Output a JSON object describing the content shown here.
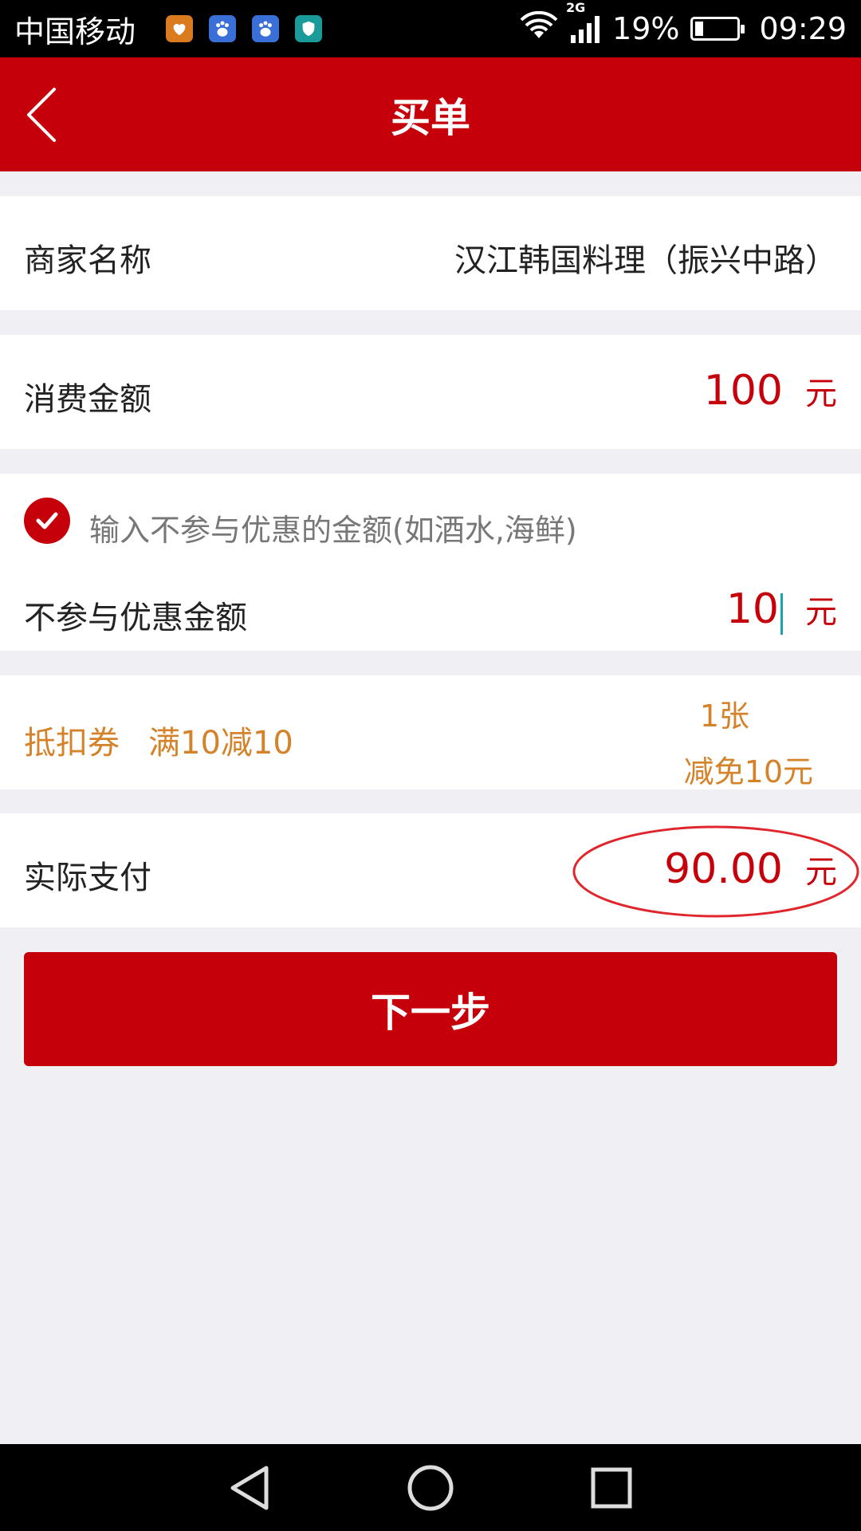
{
  "status_bar": {
    "carrier": "中国移动",
    "network": "2G",
    "battery": "19%",
    "battery_level": 0.19,
    "time": "09:29",
    "icons": [
      "health-app-icon",
      "baidu-icon",
      "baidu-icon",
      "security-shield-icon",
      "wifi-icon",
      "signal-icon",
      "battery-icon"
    ]
  },
  "header": {
    "title": "买单",
    "back_icon": "chevron-left-icon"
  },
  "merchant": {
    "label": "商家名称",
    "value": "汉江韩国料理（振兴中路）"
  },
  "consumption": {
    "label": "消费金额",
    "amount": "100",
    "unit": "元"
  },
  "exclusion": {
    "checkbox_checked": true,
    "hint": "输入不参与优惠的金额(如酒水,海鲜)",
    "label": "不参与优惠金额",
    "amount": "10",
    "unit": "元"
  },
  "coupon": {
    "label": "抵扣券",
    "rule": "满10减10",
    "count": "1张",
    "discount": "减免10元"
  },
  "actual_payment": {
    "label": "实际支付",
    "amount": "90.00",
    "unit": "元"
  },
  "next_button": {
    "label": "下一步"
  },
  "colors": {
    "brand_red": "#c6000b",
    "coupon_orange": "#d4832b",
    "background": "#efeff4",
    "annotation_red": "#e0262d"
  }
}
